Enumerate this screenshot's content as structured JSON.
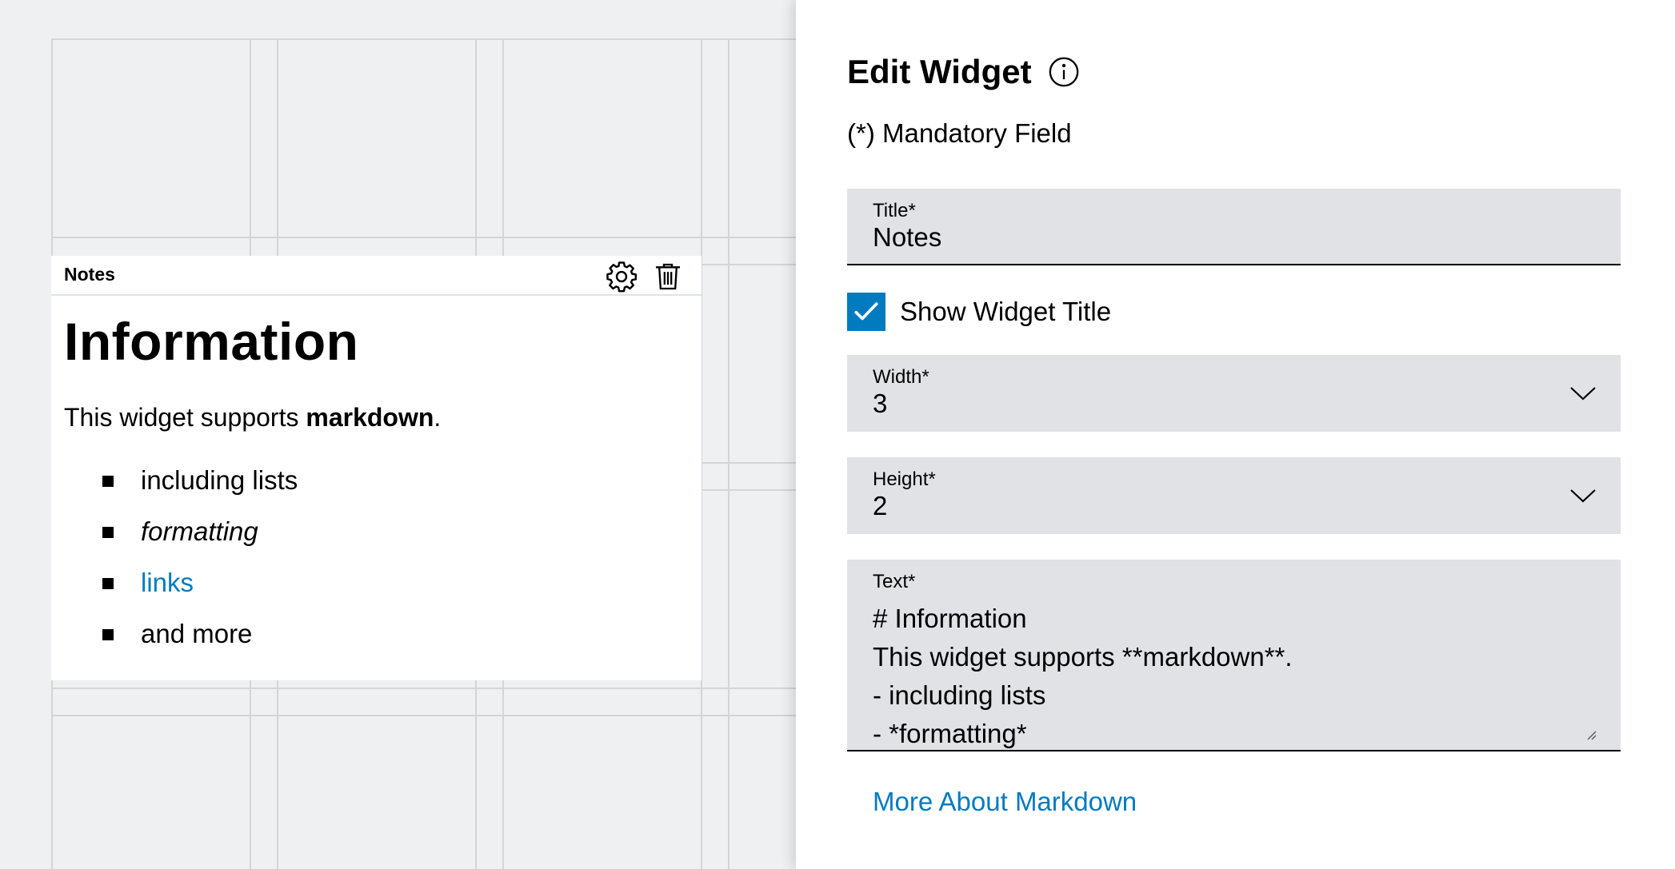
{
  "widget": {
    "header_title": "Notes",
    "heading": "Information",
    "paragraph_prefix": "This widget supports ",
    "paragraph_bold": "markdown",
    "paragraph_suffix": ".",
    "list_items": [
      "including lists",
      "formatting",
      "links",
      "and more"
    ],
    "icons": {
      "settings": "gear-icon",
      "delete": "trash-icon"
    }
  },
  "panel": {
    "title": "Edit Widget",
    "info_icon": "info-icon",
    "mandatory_note": "(*) Mandatory Field",
    "title_field": {
      "label": "Title*",
      "value": "Notes"
    },
    "show_title": {
      "label": "Show Widget Title",
      "checked": true
    },
    "width_field": {
      "label": "Width*",
      "value": "3"
    },
    "height_field": {
      "label": "Height*",
      "value": "2"
    },
    "text_field": {
      "label": "Text*",
      "lines": [
        "# Information",
        "This widget supports **markdown**.",
        "- including lists",
        "- *formatting*"
      ]
    },
    "more_link": "More About Markdown"
  },
  "colors": {
    "accent": "#007bc0",
    "field_bg": "#e0e2e5",
    "canvas_bg": "#eff0f2",
    "grid_line": "#d3d5d8"
  }
}
